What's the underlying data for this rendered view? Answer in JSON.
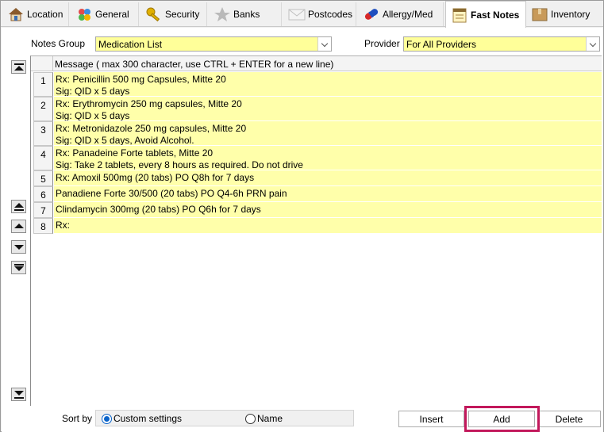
{
  "tabs": [
    {
      "label": "Location",
      "icon": "house-icon"
    },
    {
      "label": "General",
      "icon": "cubes-icon"
    },
    {
      "label": "Security",
      "icon": "key-icon"
    },
    {
      "label": "Banks",
      "icon": "star-icon"
    },
    {
      "label": "Postcodes",
      "icon": "envelope-icon"
    },
    {
      "label": "Allergy/Med",
      "icon": "capsule-icon"
    },
    {
      "label": "Fast Notes",
      "icon": "notepad-icon"
    },
    {
      "label": "Inventory",
      "icon": "box-icon"
    }
  ],
  "active_tab": "Fast Notes",
  "notes_group": {
    "label": "Notes Group",
    "value": "Medication List"
  },
  "provider": {
    "label": "Provider",
    "value": "For All Providers"
  },
  "grid": {
    "header": "Message ( max 300 character, use CTRL + ENTER for a new line)",
    "rows": [
      {
        "num": "1",
        "text": "Rx: Penicillin 500 mg Capsules, Mitte 20\nSig: QID x 5 days"
      },
      {
        "num": "2",
        "text": "Rx: Erythromycin 250 mg capsules, Mitte 20\nSig: QID x 5 days"
      },
      {
        "num": "3",
        "text": "Rx: Metronidazole 250 mg capsules, Mitte 20\nSig: QID x 5 days, Avoid Alcohol."
      },
      {
        "num": "4",
        "text": "Rx: Panadeine Forte tablets, Mitte 20\nSig: Take 2 tablets, every 8 hours as required. Do not drive"
      },
      {
        "num": "5",
        "text": "Rx: Amoxil 500mg (20 tabs) PO Q8h for 7 days"
      },
      {
        "num": "6",
        "text": "Panadiene Forte 30/500 (20 tabs) PO Q4-6h PRN pain"
      },
      {
        "num": "7",
        "text": "Clindamycin 300mg (20 tabs) PO Q6h for 7 days"
      },
      {
        "num": "8",
        "text": "Rx:"
      }
    ]
  },
  "sort": {
    "label": "Sort by",
    "options": [
      "Custom settings",
      "Name"
    ],
    "selected": "Custom settings"
  },
  "buttons": {
    "insert": "Insert",
    "add": "Add",
    "delete": "Delete"
  },
  "colors": {
    "row_bg": "#ffffaa",
    "combo_bg": "#ffff99",
    "highlight": "#c2185b",
    "radio_accent": "#0a63c9"
  }
}
